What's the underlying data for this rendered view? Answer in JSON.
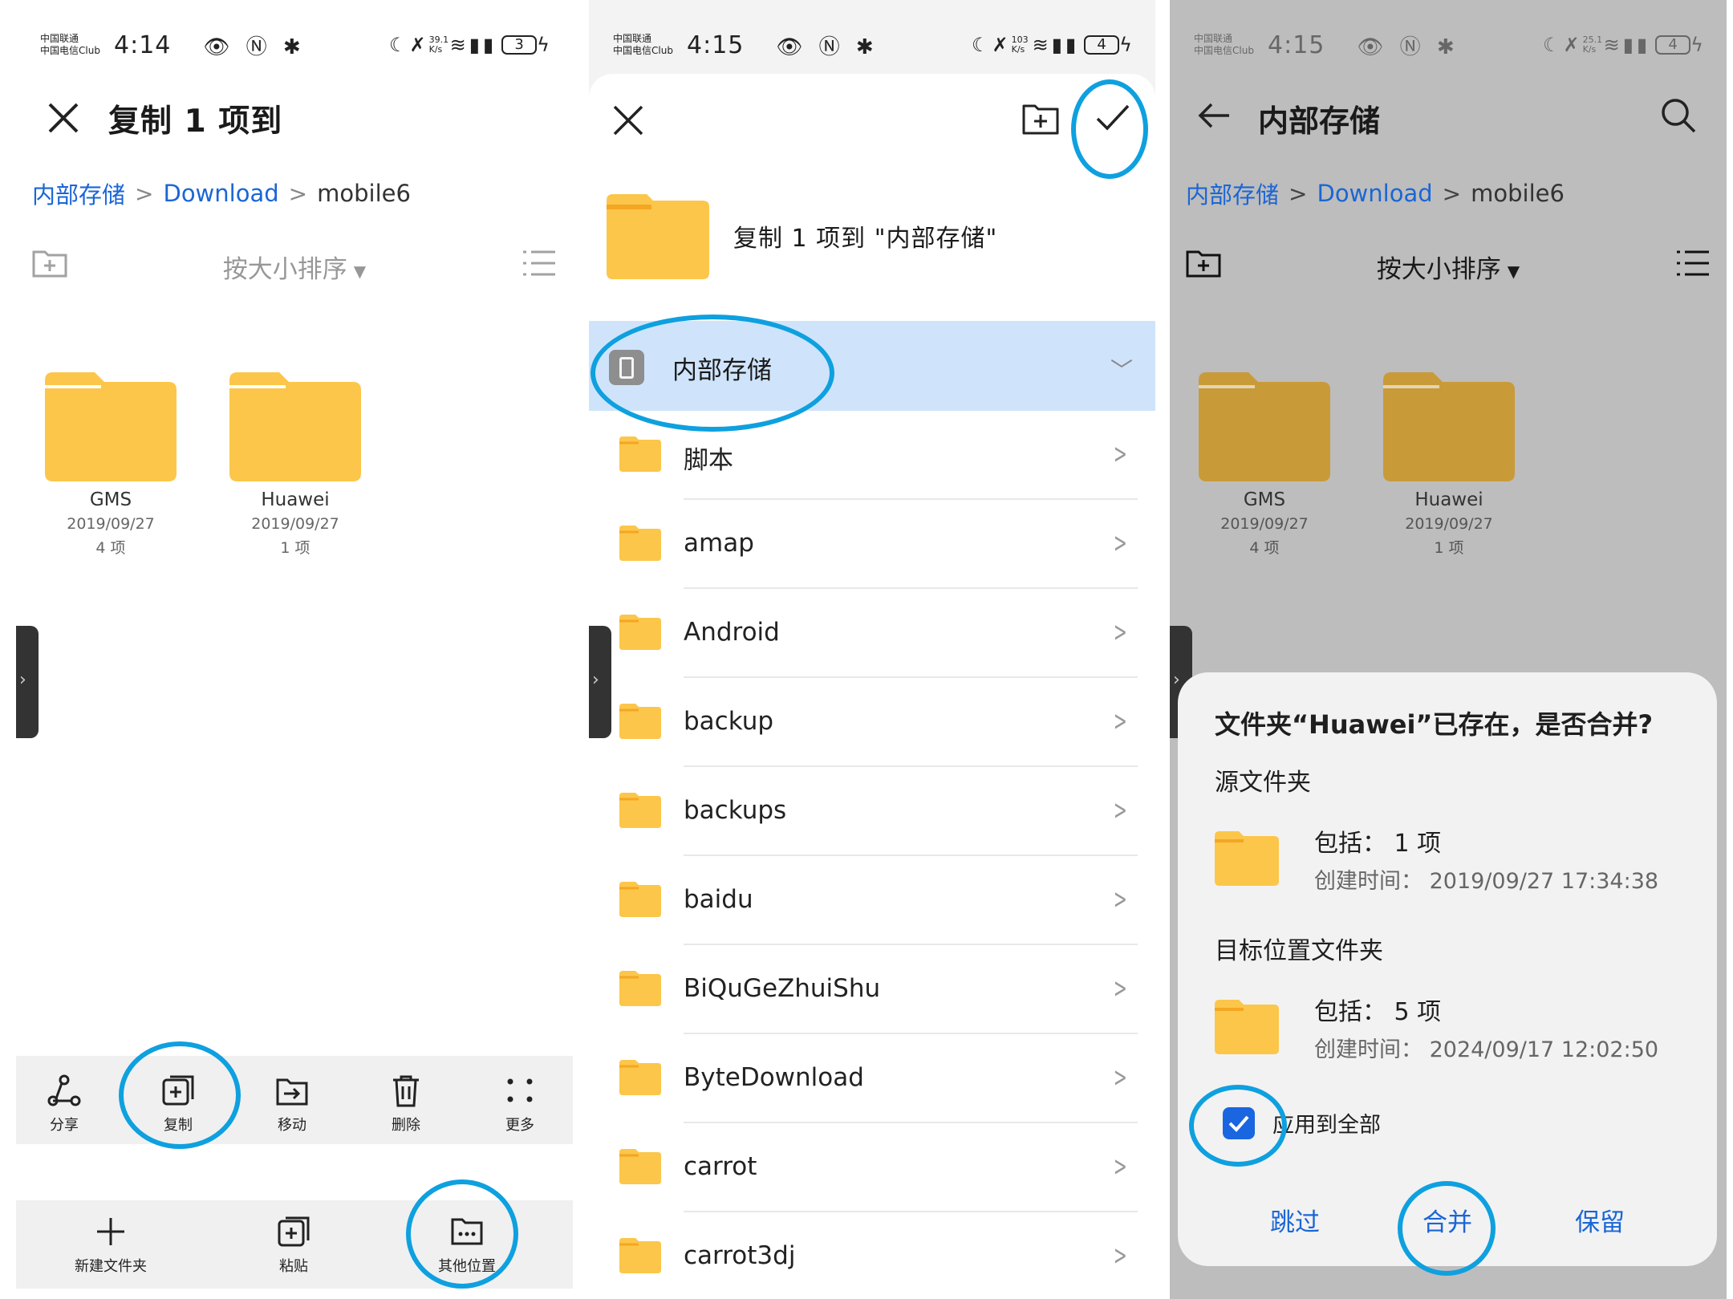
{
  "panel1": {
    "status": {
      "carrier_line1": "中国联通",
      "carrier_line2": "中国电信Club",
      "time": "4:14",
      "speed_line1": "39.1",
      "speed_line2": "K/s",
      "battery": "3"
    },
    "title": "复制 1 项到",
    "breadcrumb": {
      "root": "内部存储",
      "sep": ">",
      "download": "Download",
      "current": "mobile6"
    },
    "sort_label": "按大小排序",
    "folders": [
      {
        "name": "GMS",
        "date": "2019/09/27",
        "count": "4 项"
      },
      {
        "name": "Huawei",
        "date": "2019/09/27",
        "count": "1 项"
      }
    ],
    "actions": [
      {
        "label": "分享",
        "icon": "share-icon"
      },
      {
        "label": "复制",
        "icon": "copy-icon"
      },
      {
        "label": "移动",
        "icon": "move-icon"
      },
      {
        "label": "删除",
        "icon": "delete-icon"
      },
      {
        "label": "更多",
        "icon": "more-icon"
      }
    ],
    "bottom": [
      {
        "label": "新建文件夹",
        "icon": "plus-icon"
      },
      {
        "label": "粘贴",
        "icon": "paste-icon"
      },
      {
        "label": "其他位置",
        "icon": "other-location-icon"
      }
    ]
  },
  "panel2": {
    "status": {
      "carrier_line1": "中国联通",
      "carrier_line2": "中国电信Club",
      "time": "4:15",
      "speed_line1": "103",
      "speed_line2": "K/s",
      "battery": "4"
    },
    "copy_text": "复制 1 项到 \"内部存储\"",
    "root_label": "内部存储",
    "folders": [
      "脚本",
      "amap",
      "Android",
      "backup",
      "backups",
      "baidu",
      "BiQuGeZhuiShu",
      "ByteDownload",
      "carrot",
      "carrot3dj"
    ]
  },
  "panel3": {
    "status": {
      "carrier_line1": "中国联通",
      "carrier_line2": "中国电信Club",
      "time": "4:15",
      "speed_line1": "25.1",
      "speed_line2": "K/s",
      "battery": "4"
    },
    "title": "内部存储",
    "breadcrumb": {
      "root": "内部存储",
      "sep": ">",
      "download": "Download",
      "current": "mobile6"
    },
    "sort_label": "按大小排序",
    "folders": [
      {
        "name": "GMS",
        "date": "2019/09/27",
        "count": "4 项"
      },
      {
        "name": "Huawei",
        "date": "2019/09/27",
        "count": "1 项"
      }
    ],
    "dialog": {
      "title": "文件夹“Huawei”已存在，是否合并?",
      "source_label": "源文件夹",
      "source_include": "包括：  1 项",
      "source_time": "创建时间：  2019/09/27 17:34:38",
      "target_label": "目标位置文件夹",
      "target_include": "包括：  5 项",
      "target_time": "创建时间：  2024/09/17 12:02:50",
      "apply_all": "应用到全部",
      "apply_all_checked": true,
      "skip": "跳过",
      "merge": "合并",
      "keep": "保留"
    }
  },
  "colors": {
    "accent": "#1a66d6",
    "highlight": "#cfe4fb",
    "folder": "#fcc64a",
    "circle": "#0ea0df"
  }
}
